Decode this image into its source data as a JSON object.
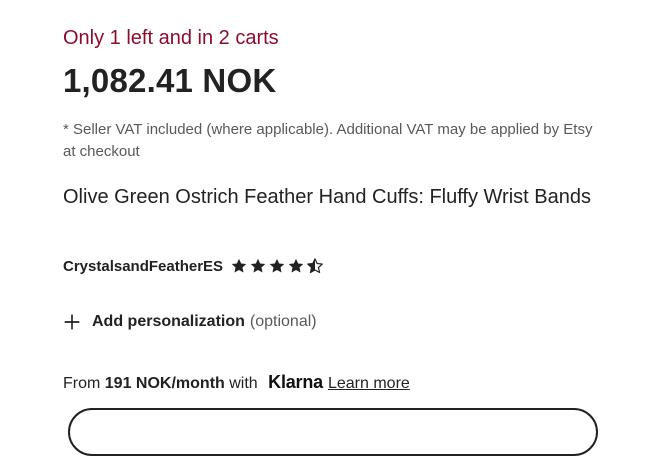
{
  "listing": {
    "stock_message": "Only 1 left and in 2 carts",
    "price": "1,082.41 NOK",
    "vat_note": "* Seller VAT included (where applicable). Additional VAT may be applied by Etsy at checkout",
    "title": "Olive Green Ostrich Feather Hand Cuffs: Fluffy Wrist Bands",
    "shop_name": "CrystalsandFeatherES",
    "rating": 4.5,
    "rating_max": 5
  },
  "personalization": {
    "icon": "plus-icon",
    "label": "Add personalization",
    "optional": "(optional)"
  },
  "klarna": {
    "prefix": "From ",
    "amount": "191 NOK/month",
    "mid": " with ",
    "brand": "Klarna",
    "link": "Learn more"
  },
  "colors": {
    "stock_text": "#8c0c2e",
    "primary_text": "#222222",
    "muted_text": "#595959"
  }
}
